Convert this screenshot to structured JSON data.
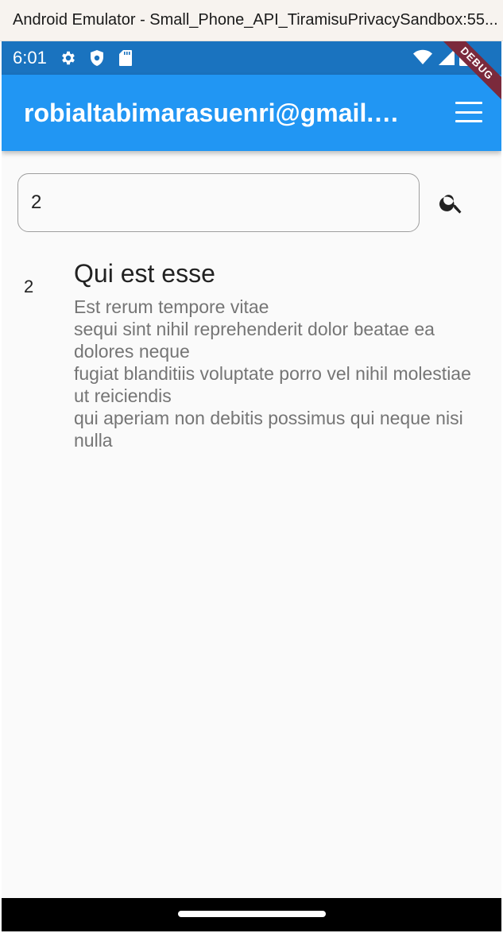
{
  "window": {
    "title": "Android Emulator - Small_Phone_API_TiramisuPrivacySandbox:55..."
  },
  "status_bar": {
    "time": "6:01",
    "left_icons": [
      "settings-icon",
      "shield-icon",
      "sd-card-icon"
    ],
    "right_icons": [
      "wifi-icon",
      "signal-icon",
      "battery-icon"
    ],
    "debug_label": "DEBUG"
  },
  "app_bar": {
    "title": "robialtabimarasuenri@gmail.com",
    "menu_icon": "menu-icon"
  },
  "search": {
    "value": "2",
    "icon": "search-icon"
  },
  "results": [
    {
      "id": "2",
      "title": "Qui est esse",
      "body": "Est rerum tempore vitae\nsequi sint nihil reprehenderit dolor beatae ea dolores neque\nfugiat blanditiis voluptate porro vel nihil molestiae ut reiciendis\nqui aperiam non debitis possimus qui neque nisi nulla"
    }
  ],
  "colors": {
    "app_bar": "#2196f3",
    "status_bar": "#1a73bf",
    "background": "#fafafa",
    "debug_banner": "#7b2a3c"
  }
}
